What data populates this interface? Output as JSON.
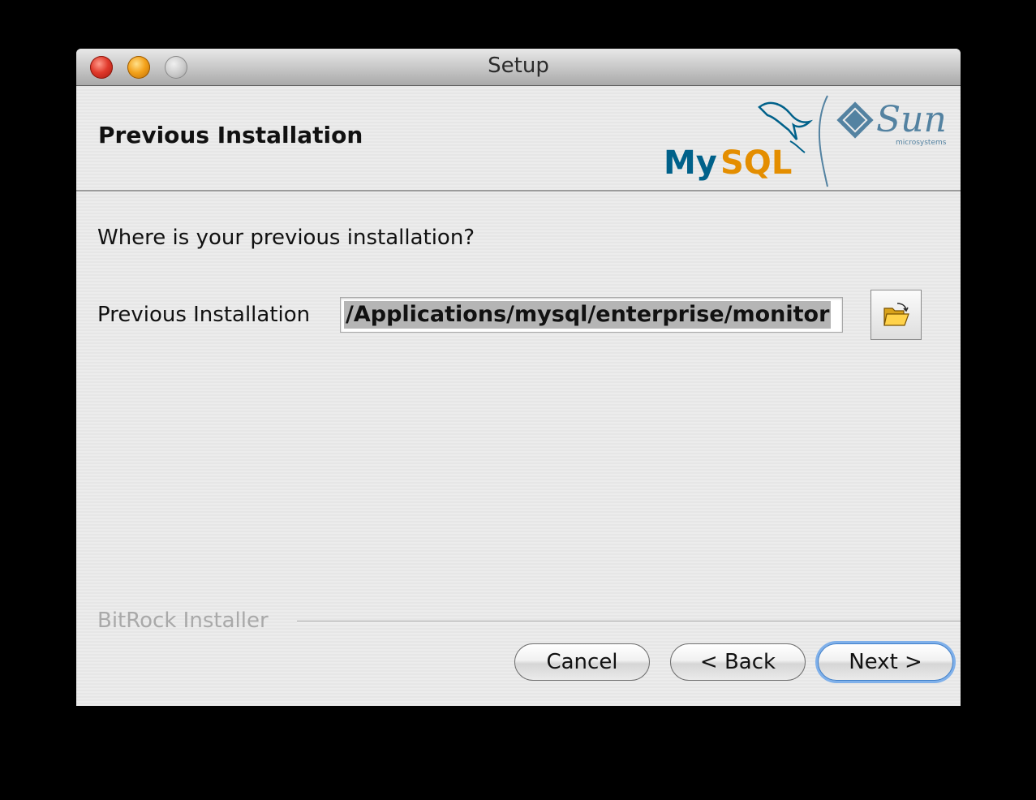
{
  "window": {
    "title": "Setup"
  },
  "header": {
    "title": "Previous Installation",
    "logo_mysql": "MySQL",
    "logo_sun": "Sun",
    "logo_sun_sub": "microsystems"
  },
  "main": {
    "prompt": "Where is your previous installation?",
    "field_label": "Previous Installation",
    "field_value": "/Applications/mysql/enterprise/monitor",
    "browse_icon": "folder-open-icon"
  },
  "footer": {
    "brand": "BitRock Installer",
    "buttons": {
      "cancel": "Cancel",
      "back": "< Back",
      "next": "Next >"
    }
  },
  "colors": {
    "mysql_blue": "#00618a",
    "mysql_orange": "#e48e00",
    "sun_blue": "#5382a1",
    "default_button_glow": "#7fb0ea"
  }
}
